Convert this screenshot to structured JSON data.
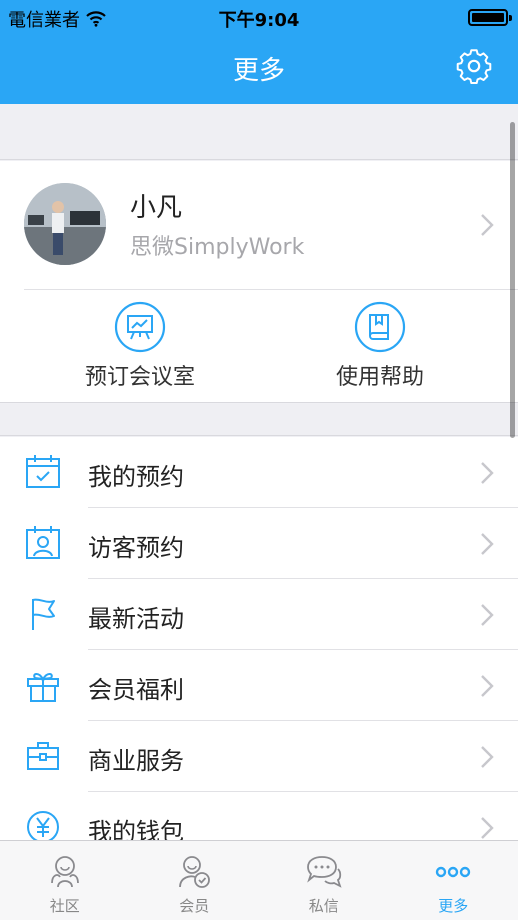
{
  "status_bar": {
    "carrier": "電信業者",
    "time": "下午9:04"
  },
  "nav": {
    "title": "更多",
    "settings_icon": "gear-icon"
  },
  "profile": {
    "name": "小凡",
    "org": "思微SimplyWork"
  },
  "quick_actions": [
    {
      "label": "预订会议室",
      "icon": "presentation-board-icon"
    },
    {
      "label": "使用帮助",
      "icon": "book-icon"
    }
  ],
  "menu": [
    {
      "label": "我的预约",
      "icon": "calendar-check-icon"
    },
    {
      "label": "访客预约",
      "icon": "visitor-calendar-icon"
    },
    {
      "label": "最新活动",
      "icon": "flag-icon"
    },
    {
      "label": "会员福利",
      "icon": "gift-icon"
    },
    {
      "label": "商业服务",
      "icon": "briefcase-icon"
    },
    {
      "label": "我的钱包",
      "icon": "yuan-icon"
    }
  ],
  "tabs": [
    {
      "label": "社区",
      "icon": "community-icon",
      "active": false
    },
    {
      "label": "会员",
      "icon": "member-icon",
      "active": false
    },
    {
      "label": "私信",
      "icon": "message-icon",
      "active": false
    },
    {
      "label": "更多",
      "icon": "more-icon",
      "active": true
    }
  ],
  "colors": {
    "accent": "#2aa6f5",
    "background": "#efeff3",
    "chevron": "#c7c7cc"
  }
}
